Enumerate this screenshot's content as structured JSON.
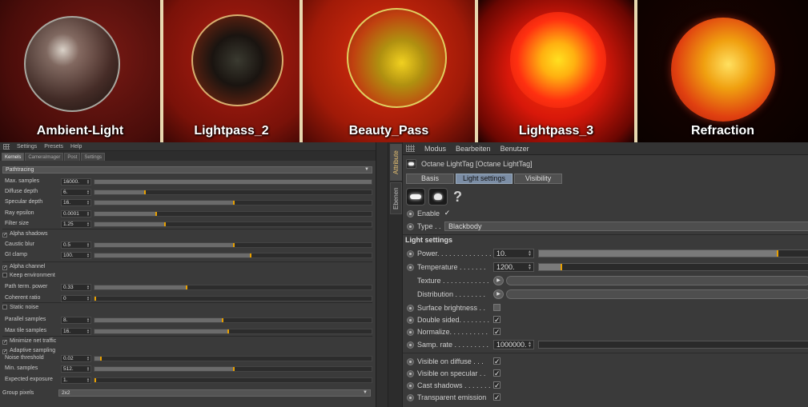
{
  "renders": [
    {
      "label": "Ambient-Light"
    },
    {
      "label": "Lightpass_2"
    },
    {
      "label": "Beauty_Pass"
    },
    {
      "label": "Lightpass_3"
    },
    {
      "label": "Refraction"
    }
  ],
  "octane_settings": {
    "menu": [
      "Settings",
      "Presets",
      "Help"
    ],
    "tabs": [
      "Kernels",
      "CameraImager",
      "Post",
      "Settings"
    ],
    "active_tab": "Kernels",
    "kernel": "Pathtracing",
    "params": [
      {
        "label": "Max. samples",
        "value": "16000.",
        "fraction": 1.0
      },
      {
        "label": "Diffuse depth",
        "value": "6.",
        "fraction": 0.18
      },
      {
        "label": "Specular depth",
        "value": "16.",
        "fraction": 0.5
      },
      {
        "label": "Ray epsilon",
        "value": "0.0001",
        "fraction": 0.22
      },
      {
        "label": "Filter size",
        "value": "1.25",
        "fraction": 0.25
      },
      {
        "label": "Caustic blur",
        "value": "0.5",
        "fraction": 0.5
      },
      {
        "label": "GI clamp",
        "value": "100.",
        "fraction": 0.56
      },
      {
        "label": "Path term. power",
        "value": "0.33",
        "fraction": 0.33
      },
      {
        "label": "Coherent ratio",
        "value": "0",
        "fraction": 0.0
      },
      {
        "label": "Parallel samples",
        "value": "8.",
        "fraction": 0.46
      },
      {
        "label": "Max tile samples",
        "value": "16.",
        "fraction": 0.48
      },
      {
        "label": "Noise threshold",
        "value": "0.02",
        "fraction": 0.02
      },
      {
        "label": "Min. samples",
        "value": "512.",
        "fraction": 0.5
      },
      {
        "label": "Expected exposure",
        "value": "1.",
        "fraction": 0.0
      }
    ],
    "checks": [
      {
        "label": "Alpha shadows",
        "checked": true
      },
      {
        "label": "Alpha channel",
        "checked": true
      },
      {
        "label": "Keep environment",
        "checked": false
      },
      {
        "label": "Static noise",
        "checked": false
      },
      {
        "label": "Minimize net traffic",
        "checked": true
      },
      {
        "label": "Adaptive sampling",
        "checked": true
      }
    ],
    "group_pixels_label": "Group pixels",
    "group_pixels_value": "2x2"
  },
  "side_tabs": [
    "Attribute",
    "Ebenen"
  ],
  "attribute": {
    "menu": [
      "Modus",
      "Bearbeiten",
      "Benutzer"
    ],
    "object_title": "Octane LightTag [Octane LightTag]",
    "tabs": [
      "Basis",
      "Light settings",
      "Visibility"
    ],
    "active_tab": "Light settings",
    "help_glyph": "?",
    "enable_label": "Enable",
    "type_label": "Type . .",
    "type_value": "Blackbody",
    "section_title": "Light settings",
    "power": {
      "label": "Power. . . . . . . . . . . . . .",
      "value": "10.",
      "fraction": 0.88
    },
    "temperature": {
      "label": "Temperature . . . . . . .",
      "value": "1200.",
      "fraction": 0.08
    },
    "texture_label": "Texture . . . . . . . . . . . .",
    "distribution_label": "Distribution . . . . . . . .",
    "surface_brightness": "Surface brightness . .",
    "double_sided": "Double sided. . . . . . . .",
    "normalize": "Normalize. . . . . . . . . .",
    "samp_rate": {
      "label": "Samp. rate . . . . . . . . .",
      "value": "1000000.",
      "fraction": 0.0
    },
    "visible_diffuse": "Visible on diffuse . . .",
    "visible_specular": "Visible on specular . .",
    "cast_shadows": "Cast shadows . . . . . . .",
    "transparent_emission": "Transparent emission",
    "check_glyph": "✓"
  },
  "colors": {
    "accent": "#e8a000",
    "active_tab": "#7c8ea6",
    "panel_bg": "#3a3a3a"
  }
}
